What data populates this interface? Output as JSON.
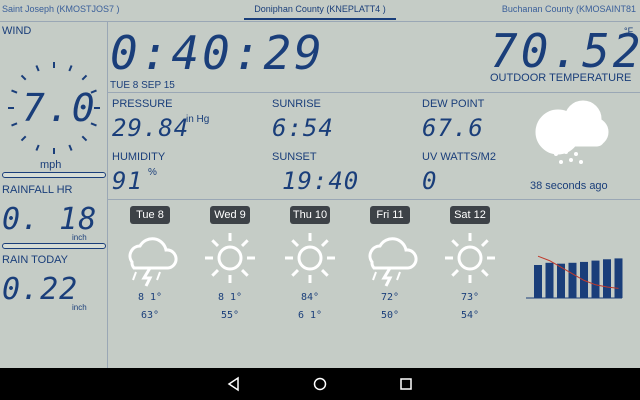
{
  "stations": {
    "left": "Saint Joseph (KMOSTJOS7 )",
    "center": "Doniphan County (KNEPLATT4 )",
    "right": "Buchanan County (KMOSAINT81"
  },
  "wind": {
    "label": "WIND",
    "value": "7.0",
    "unit": "mph",
    "bar_level": 0.0
  },
  "clock": {
    "time": "0:40:29",
    "date": "TUE 8 SEP  15"
  },
  "outdoor": {
    "value": "70.52",
    "unit": "°F",
    "label": "OUTDOOR TEMPERATURE"
  },
  "pressure": {
    "label": "PRESSURE",
    "value": "29.84",
    "unit": "in Hg"
  },
  "sunrise": {
    "label": "SUNRISE",
    "value": "6:54"
  },
  "dewpoint": {
    "label": "DEW POINT",
    "value": "67.6"
  },
  "humidity": {
    "label": "HUMIDITY",
    "value": "91",
    "unit": "%"
  },
  "sunset": {
    "label": "SUNSET",
    "value": "19:40"
  },
  "uv": {
    "label": "UV WATTS/M2",
    "value": "0"
  },
  "current_icon": {
    "icon": "rain-cloud-icon",
    "updated": "38 seconds ago"
  },
  "rainfall_hr": {
    "label": "RAINFALL HR",
    "value": "0. 18",
    "unit": "inch"
  },
  "rain_today": {
    "label": "RAIN TODAY",
    "value": "0.22",
    "unit": "inch"
  },
  "forecast": [
    {
      "day": "Tue 8",
      "icon": "thunderstorm-icon",
      "high": "8 1°",
      "low": "63°"
    },
    {
      "day": "Wed 9",
      "icon": "sun-icon",
      "high": "8 1°",
      "low": "55°"
    },
    {
      "day": "Thu 10",
      "icon": "sun-icon",
      "high": "84°",
      "low": "6 1°"
    },
    {
      "day": "Fri 11",
      "icon": "thunderstorm-icon",
      "high": "72°",
      "low": "50°"
    },
    {
      "day": "Sat 12",
      "icon": "sun-icon",
      "high": "73°",
      "low": "54°"
    }
  ],
  "mini_chart": {
    "bars": [
      0.75,
      0.8,
      0.78,
      0.8,
      0.82,
      0.85,
      0.88,
      0.9
    ],
    "line": [
      0.95,
      0.85,
      0.7,
      0.55,
      0.4,
      0.3,
      0.25,
      0.22
    ]
  },
  "colors": {
    "background": "#c5ccc6",
    "accent": "#1a3e7a",
    "badge": "#3d4247"
  }
}
